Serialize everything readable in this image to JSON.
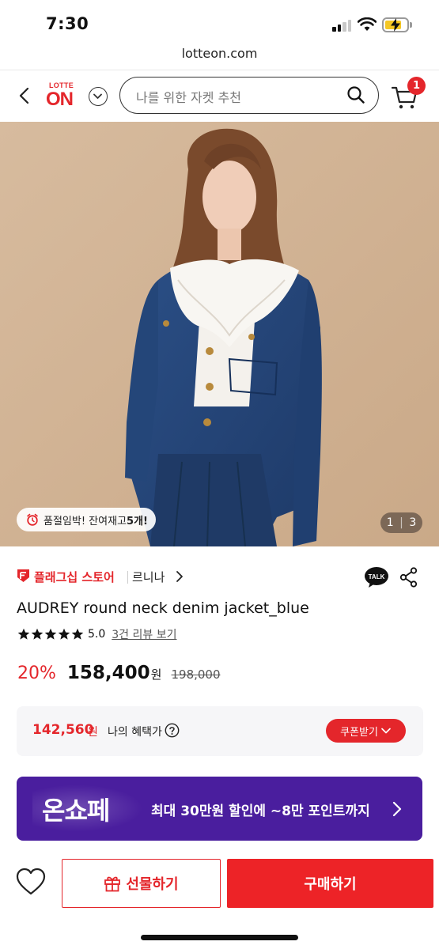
{
  "status_bar": {
    "time": "7:30"
  },
  "browser": {
    "url": "lotteon.com"
  },
  "header": {
    "logo_top": "LOTTE",
    "logo_main": "ON",
    "search_placeholder": "나를 위한 자켓 추천",
    "cart_count": "1"
  },
  "hero": {
    "stock_text": "품절임박! 잔여재고 ",
    "stock_count": "5개!",
    "page_current": "1",
    "page_total": "3"
  },
  "product": {
    "store_type": "플래그십 스토어",
    "store_name": "르니나",
    "title": "AUDREY round neck denim jacket_blue",
    "rating": "5.0",
    "rating_stars": 5,
    "review_link": "3건 리뷰 보기",
    "discount": "20%",
    "price": "158,400",
    "won": "원",
    "original_price": "198,000"
  },
  "benefit": {
    "price": "142,560",
    "won": "원",
    "label": "나의 혜택가",
    "coupon_button": "쿠폰받기"
  },
  "banner": {
    "logo": "온쇼페",
    "text": "최대 30만원 할인에 ~8만 포인트까지"
  },
  "bottom_bar": {
    "gift_label": "선물하기",
    "buy_label": "구매하기"
  },
  "colors": {
    "brand_red": "#e4262b",
    "banner_purple": "#4a1e9e",
    "benefit_bg": "#f6f6f8"
  },
  "icons": [
    "back-icon",
    "chevron-down-icon",
    "search-icon",
    "cart-icon",
    "alarm-clock-icon",
    "flagship-icon",
    "chevron-right-icon",
    "talk-icon",
    "share-icon",
    "star-icon",
    "help-icon",
    "heart-icon",
    "gift-icon"
  ]
}
